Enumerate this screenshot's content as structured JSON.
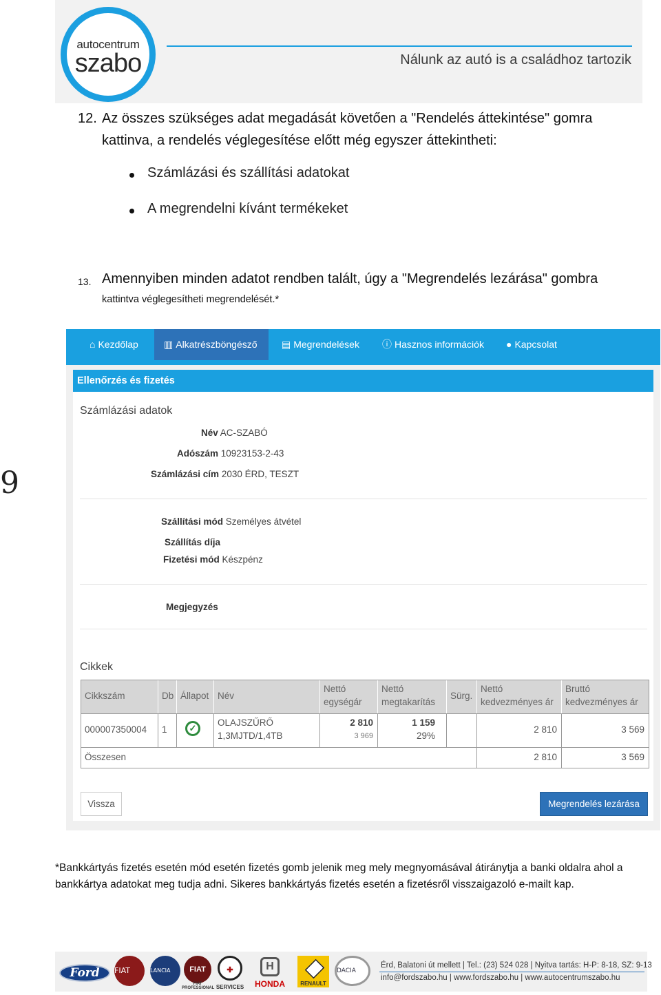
{
  "header": {
    "logo_top": "autocentrum",
    "logo_bottom": "szabo",
    "slogan": "Nálunk az autó is a családhoz tartozik"
  },
  "steps": [
    {
      "number": "12.",
      "line1": "Az összes szükséges adat megadását követően a \"Rendelés áttekintése\" gomra",
      "line2": "kattinva, a rendelés véglegesítése előtt még egyszer áttekintheti:",
      "bullets": [
        "Számlázási és szállítási adatokat",
        "A megrendelni kívánt termékeket"
      ]
    },
    {
      "number": "13.",
      "line1": "Amennyiben minden adatot rendben talált, úgy a \"Megrendelés lezárása\" gombra",
      "line2": "kattintva véglegesítheti megrendelését.*"
    }
  ],
  "page_number": "9",
  "app": {
    "nav": [
      {
        "icon": "home-icon",
        "label": "Kezdőlap"
      },
      {
        "icon": "book-icon",
        "label": "Alkatrészböngésző"
      },
      {
        "icon": "list-icon",
        "label": "Megrendelések"
      },
      {
        "icon": "info-icon",
        "label": "Hasznos információk"
      },
      {
        "icon": "user-icon",
        "label": "Kapcsolat"
      }
    ],
    "active_nav": "Alkatrészböngésző",
    "panel_title": "Ellenőrzés és fizetés",
    "billing": {
      "title": "Számlázási adatok",
      "name_label": "Név",
      "name_value": "AC-SZABÓ",
      "tax_label": "Adószám",
      "tax_value": "10923153-2-43",
      "address_label": "Számlázási cím",
      "address_value": "2030 ÉRD, TESZT"
    },
    "shipping": {
      "method_label": "Szállítási mód",
      "method_value": "Személyes átvétel",
      "fee_label": "Szállítás díja",
      "fee_value": "",
      "payment_label": "Fizetési mód",
      "payment_value": "Készpénz"
    },
    "note_label": "Megjegyzés",
    "items": {
      "title": "Cikkek",
      "headers": {
        "sku": "Cikkszám",
        "qty": "Db",
        "status": "Állapot",
        "name": "Név",
        "net_unit_1": "Nettó",
        "net_unit_2": "egységár",
        "net_save_1": "Nettó",
        "net_save_2": "megtakarítás",
        "urgent": "Sürg.",
        "net_disc_1": "Nettó",
        "net_disc_2": "kedvezményes ár",
        "gross_disc_1": "Bruttó",
        "gross_disc_2": "kedvezményes ár"
      },
      "rows": [
        {
          "sku": "000007350004",
          "qty": "1",
          "status_icon": "check-circle-icon",
          "name_1": "OLAJSZŰRŐ",
          "name_2": "1,3MJTD/1,4TB",
          "net_unit": "2 810",
          "net_unit_sub": "3 969",
          "net_save": "1 159",
          "net_save_pct": "29%",
          "net_disc": "2 810",
          "gross_disc": "3 569"
        }
      ],
      "total_label": "Összesen",
      "total_net": "2 810",
      "total_gross": "3 569"
    },
    "back_button": "Vissza",
    "submit_button": "Megrendelés lezárása"
  },
  "footnote": {
    "line1": "*Bankkártyás fizetés esetén mód esetén fizetés gomb jelenik meg mely megnyomásával átiránytja a banki oldalra ahol a",
    "line2": "bankkártya adatokat meg tudja adni. Sikeres bankkártyás fizetés esetén a fizetésről visszaigazoló e-mailt kap."
  },
  "footer": {
    "brands": [
      "Ford",
      "FIAT",
      "LANCIA",
      "FIAT PROFESSIONAL",
      "SERVICES",
      "HONDA",
      "RENAULT",
      "DACIA"
    ],
    "info_line1": "Érd, Balatoni út mellett | Tel.: (23) 524 028 | Nyitva tartás: H-P: 8-18, SZ: 9-13",
    "info_line2": "info@fordszabo.hu   |   www.fordszabo.hu   |   www.autocentrumszabo.hu"
  }
}
